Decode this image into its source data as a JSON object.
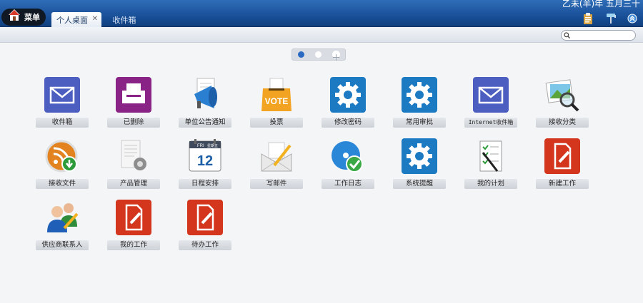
{
  "topbar": {
    "menu_label": "菜单",
    "tabs": [
      {
        "label": "个人桌面",
        "active": true
      },
      {
        "label": "收件箱",
        "active": false
      }
    ],
    "date_text": "乙未(羊)年 五月三十"
  },
  "search": {
    "value": "",
    "placeholder": ""
  },
  "pager": {
    "pages": 2,
    "current": 1
  },
  "apps": [
    {
      "label": "收件箱",
      "icon": "mail-envelope-icon"
    },
    {
      "label": "已删除",
      "icon": "trash-printer-icon"
    },
    {
      "label": "单位公告通知",
      "icon": "megaphone-icon"
    },
    {
      "label": "投票",
      "icon": "vote-box-icon"
    },
    {
      "label": "修改密码",
      "icon": "gear-icon"
    },
    {
      "label": "常用审批",
      "icon": "gear-icon"
    },
    {
      "label": "Internet收件箱",
      "icon": "mail-envelope-icon"
    },
    {
      "label": "接收分类",
      "icon": "picture-magnifier-icon"
    },
    {
      "label": "接收文件",
      "icon": "rss-download-icon"
    },
    {
      "label": "产品管理",
      "icon": "document-gear-icon"
    },
    {
      "label": "日程安排",
      "icon": "calendar-icon"
    },
    {
      "label": "写邮件",
      "icon": "letter-pen-icon"
    },
    {
      "label": "工作日志",
      "icon": "disc-check-icon"
    },
    {
      "label": "系统提醒",
      "icon": "gear-icon"
    },
    {
      "label": "我的计划",
      "icon": "checklist-pen-icon"
    },
    {
      "label": "新建工作",
      "icon": "edit-document-icon"
    },
    {
      "label": "供应商联系人",
      "icon": "users-pencil-icon"
    },
    {
      "label": "我的工作",
      "icon": "edit-document-icon"
    },
    {
      "label": "待办工作",
      "icon": "edit-document-icon"
    }
  ],
  "calendar": {
    "weekday_en": "FRI",
    "weekday_cn": "星期五",
    "day": "12"
  },
  "vote_text": "VOTE",
  "colors": {
    "topbar": "#164c93",
    "accent_blue": "#2a6ac2",
    "mail_purple": "#4c5fc0",
    "trash_purple": "#8a2386",
    "gear_blue": "#1b7ac2",
    "edit_red": "#d3361d"
  }
}
